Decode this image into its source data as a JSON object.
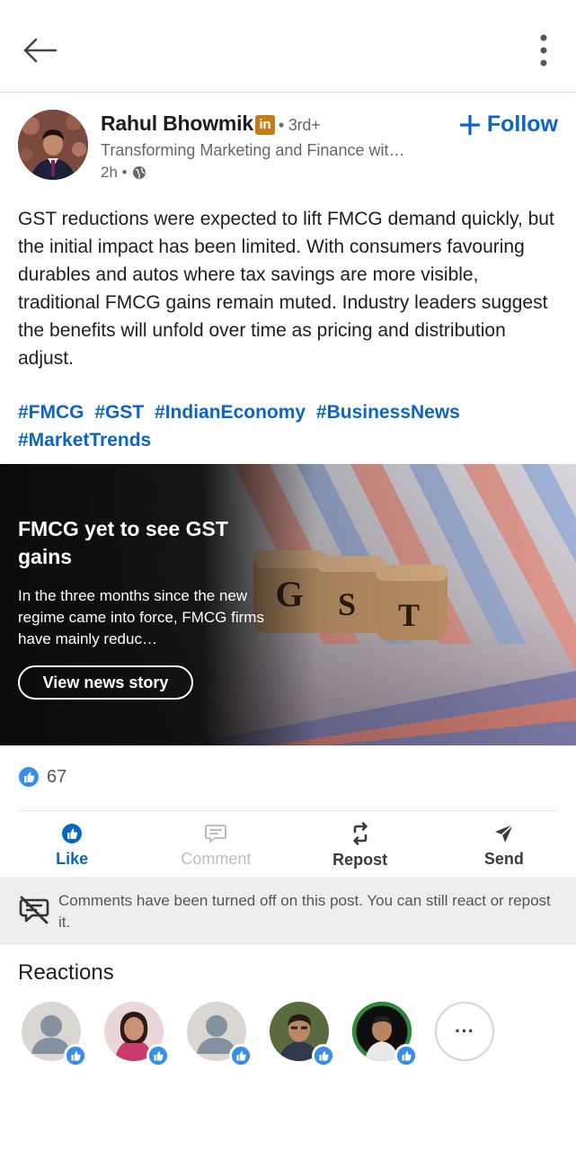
{
  "post": {
    "author_name": "Rahul Bhowmik",
    "linkedin_badge": "in",
    "degree": "• 3rd+",
    "follow_label": "Follow",
    "headline": "Transforming Marketing and Finance wit…",
    "time": "2h •",
    "text": "GST reductions were expected to lift FMCG demand quickly, but the initial impact has been limited. With consumers favouring durables and autos where tax savings are more visible, traditional FMCG gains remain muted. Industry leaders suggest the benefits will unfold over time as pricing and distribution adjust.",
    "hashtags": [
      "#FMCG",
      "#GST",
      "#IndianEconomy",
      "#BusinessNews",
      "#MarketTrends"
    ]
  },
  "news": {
    "title": "FMCG yet to see GST gains",
    "summary": "In the three months since the new regime came into force, FMCG firms have mainly reduc…",
    "button_label": "View news story",
    "dice_letters": [
      "G",
      "S",
      "T"
    ]
  },
  "social": {
    "reaction_count": "67"
  },
  "actions": {
    "like": "Like",
    "comment": "Comment",
    "repost": "Repost",
    "send": "Send"
  },
  "notice": {
    "text": "Comments have been turned off on this post. You can still react or repost it."
  },
  "reactions": {
    "title": "Reactions",
    "more_label": "···"
  },
  "icons": {
    "back": "arrow-left-icon",
    "more": "vertical-ellipsis-icon",
    "globe": "globe-icon",
    "like": "thumbs-up-icon",
    "comment": "comment-icon",
    "repost": "repost-icon",
    "send": "send-icon",
    "comments_off": "comments-off-icon"
  },
  "colors": {
    "accent": "#0a66c2",
    "linkedin_badge": "#c37d16",
    "notice_bg": "#eeeeee"
  }
}
